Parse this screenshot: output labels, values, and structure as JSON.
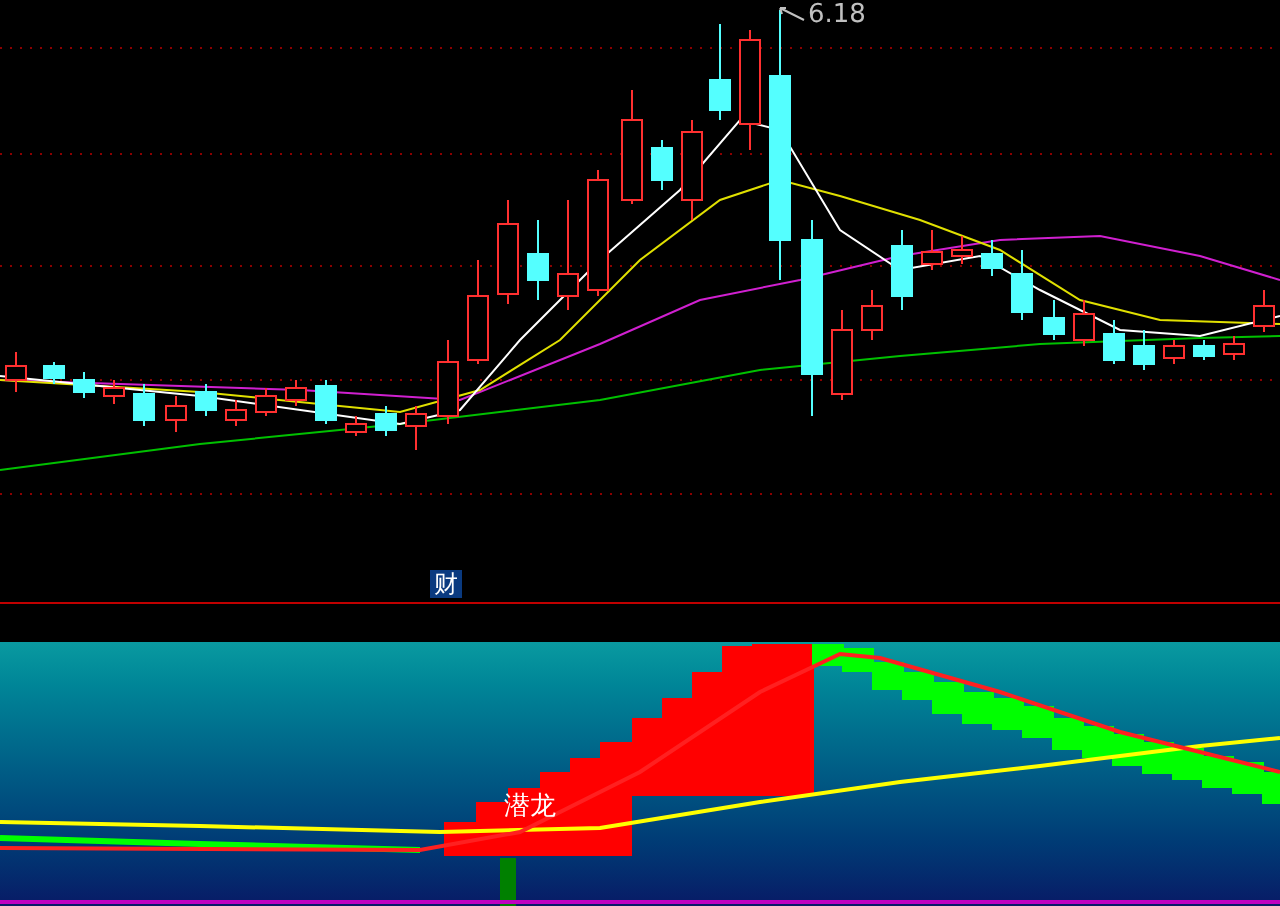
{
  "price_chart": {
    "high_label": "6.18"
  },
  "indicator_panel": {
    "title": "财",
    "signal_label": "潜龙"
  }
}
